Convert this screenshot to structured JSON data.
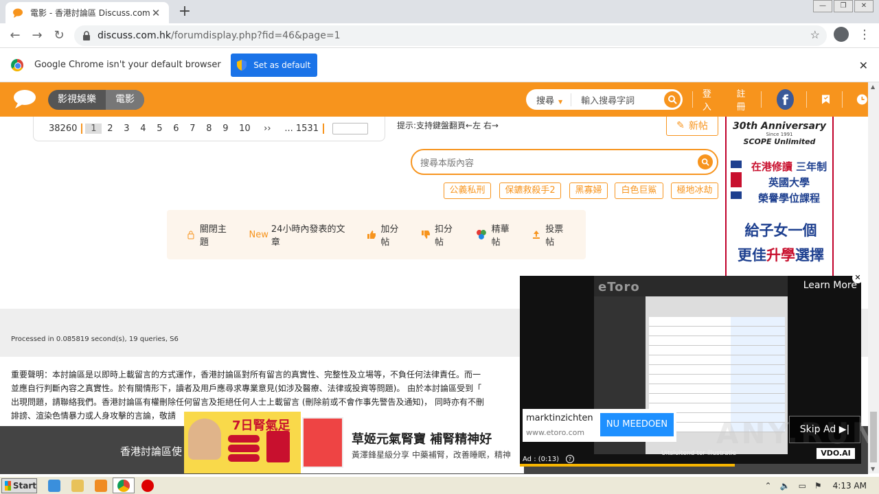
{
  "browser": {
    "tab_title": "電影 - 香港討論區 Discuss.com.hk -",
    "url_domain": "discuss.com.hk",
    "url_path": "/forumdisplay.php?fid=46&page=1",
    "infobar_message": "Google Chrome isn't your default browser",
    "set_default_label": "Set as default"
  },
  "site": {
    "nav_categories": [
      "影視娛樂",
      "電影"
    ],
    "search_type": "搜尋",
    "search_placeholder": "輸入搜尋字詞",
    "login": "登入",
    "register": "註冊",
    "facebook_letter": "f"
  },
  "pager": {
    "total": "38260",
    "pages": [
      "1",
      "2",
      "3",
      "4",
      "5",
      "6",
      "7",
      "8",
      "9",
      "10",
      "››"
    ],
    "last": "... 1531"
  },
  "content": {
    "keyboard_hint": "提示:支持鍵盤翻頁←左 右→",
    "new_post": "新帖",
    "forum_search_placeholder": "搜尋本版內容",
    "tags": [
      "公義私刑",
      "保鑣救殺手2",
      "黑寡婦",
      "白色巨鯊",
      "極地冰劫"
    ],
    "filters": {
      "closed": "關閉主題",
      "new_label": "New",
      "new_text": "24小時內發表的文章",
      "plus": "加分帖",
      "minus": "扣分帖",
      "digest": "精華帖",
      "poll": "投票帖"
    }
  },
  "right_ad": {
    "anniversary": "30th Anniversary",
    "since": "Since 1991",
    "brand": "SCOPE Unlimited",
    "line1a": "在港修讀",
    "line1b": "三年制",
    "line2": "英國大學",
    "line3": "榮譽學位課程",
    "big1": "給子女一個",
    "big2a": "更佳",
    "big2b": "升學",
    "big2c": "選擇"
  },
  "footer": {
    "processed": "Processed in 0.085819 second(s), 19 queries, S6",
    "disclaimer_lines": [
      "重要聲明：本討論區是以即時上載留言的方式運作，香港討論區對所有留言的真實性、完整性及立場等，不負任何法律責任。而一",
      "並應自行判斷內容之真實性。於有關情形下，讀者及用戶應尋求專業意見(如涉及醫療、法律或投資等問題)。 由於本討論區受到「",
      "出現問題，請聯絡我們。香港討論區有權刪除任何留言及拒絕任何人士上載留言 (刪除前或不會作事先警告及通知)， 同時亦有不刪",
      "誹謗、渲染色情暴力或人身攻擊的言論，敬請"
    ],
    "dark_text": "香港討論區使"
  },
  "bottom_ad": {
    "badge": "7日腎氣足",
    "headline": "草姬元氣腎寶 補腎精神好",
    "sub": "黃澤鋒星級分享 中藥補腎，改善睡眠，精神"
  },
  "video_ad": {
    "brand": "eToro",
    "learn_more": "Learn More",
    "advertiser": "marktinzichten",
    "domain": "www.etoro.com",
    "cta": "NU MEEDOEN",
    "skip": "Skip Ad",
    "vdo": "VDO.AI",
    "time": "Ad : (0:13)",
    "caption": "Uitsluitend ter illustratie",
    "watermark": "ANY.RUN",
    "progress": 0.63
  },
  "taskbar": {
    "start": "Start",
    "clock": "4:13 AM"
  },
  "colors": {
    "brand_orange": "#f7941d",
    "chrome_blue": "#1a73e8",
    "facebook": "#3b5998"
  }
}
